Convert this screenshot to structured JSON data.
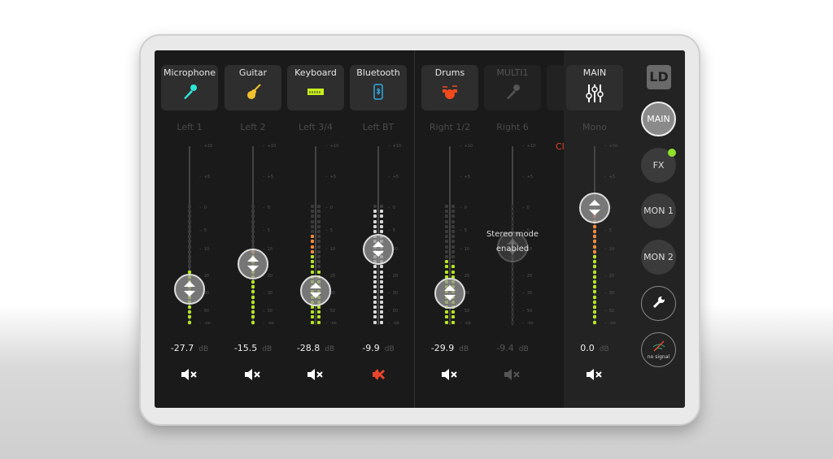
{
  "channels": [
    {
      "name": "Microphone",
      "icon": "microphone-icon",
      "icon_color": "#2ee6d6",
      "output": "Left 1",
      "value": "-27.7",
      "unit": "dB",
      "meters": [
        -18
      ],
      "meter_color": "green",
      "muted": false,
      "dimmed": false
    },
    {
      "name": "Guitar",
      "icon": "guitar-icon",
      "icon_color": "#f2c12e",
      "output": "Left 2",
      "value": "-15.5",
      "unit": "dB",
      "meters": [
        -10
      ],
      "meter_color": "green",
      "muted": false,
      "dimmed": false
    },
    {
      "name": "Keyboard",
      "icon": "keyboard-icon",
      "icon_color": "#c8f01e",
      "output": "Left 3/4",
      "value": "-28.8",
      "unit": "dB",
      "meters": [
        -6,
        -18
      ],
      "meter_color": "green",
      "muted": false,
      "dimmed": false
    },
    {
      "name": "Bluetooth",
      "icon": "bluetooth-phone-icon",
      "icon_color": "#2fa8e0",
      "output": "Left BT",
      "value": "-9.9",
      "unit": "dB",
      "meters": [
        0,
        0
      ],
      "meter_color": "white",
      "muted": true,
      "dimmed": false
    },
    {
      "name": "Drums",
      "icon": "drums-icon",
      "icon_color": "#f04a1e",
      "output": "Right 1/2",
      "value": "-29.9",
      "unit": "dB",
      "meters": [
        -14,
        -16
      ],
      "meter_color": "green",
      "muted": false,
      "dimmed": false
    },
    {
      "name": "MULTI1",
      "icon": "microphone-icon",
      "icon_color": "#555555",
      "output": "Right 6",
      "value": "-9.4",
      "unit": "dB",
      "meters": [
        -100
      ],
      "meter_color": "gray",
      "muted": false,
      "dimmed": true
    }
  ],
  "stereo_notice": "Stereo mode enabled",
  "clip_label": "Cl",
  "main": {
    "name": "MAIN",
    "icon": "mixer-sliders-icon",
    "output": "Mono",
    "value": "0.0",
    "unit": "dB",
    "meters": [
      0
    ]
  },
  "scale": [
    "+10",
    "+5",
    "0",
    "5",
    "10",
    "20",
    "30",
    "50",
    "-oo"
  ],
  "sidebar": {
    "logo": "LD",
    "buttons": [
      {
        "label": "MAIN",
        "active": true
      },
      {
        "label": "FX",
        "indicator": "#8fe02a"
      },
      {
        "label": "MON 1"
      },
      {
        "label": "MON 2"
      },
      {
        "icon": "wrench-icon"
      },
      {
        "icon": "no-signal-icon",
        "label": "no signal"
      }
    ]
  },
  "colors": {
    "green": "#b4e61e",
    "orange": "#f08a3a",
    "red": "#e8452c",
    "white": "#d8d8d8"
  }
}
